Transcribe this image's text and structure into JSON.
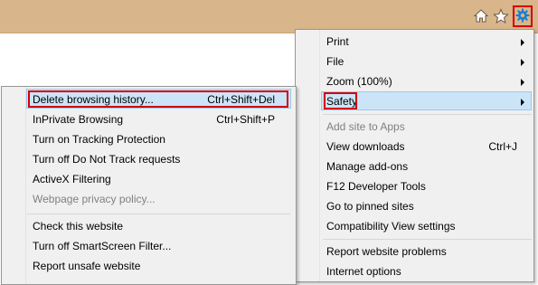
{
  "toolbar": {
    "icons": [
      "home-icon",
      "favorites-star-icon",
      "tools-gear-icon"
    ]
  },
  "main_menu": {
    "items": [
      {
        "label": "Print",
        "has_submenu": true
      },
      {
        "label": "File",
        "has_submenu": true
      },
      {
        "label": "Zoom (100%)",
        "has_submenu": true
      },
      {
        "label": "Safety",
        "has_submenu": true,
        "highlighted": true
      },
      {
        "label": "Add site to Apps",
        "disabled": true
      },
      {
        "label": "View downloads",
        "shortcut": "Ctrl+J"
      },
      {
        "label": "Manage add-ons"
      },
      {
        "label": "F12 Developer Tools"
      },
      {
        "label": "Go to pinned sites"
      },
      {
        "label": "Compatibility View settings"
      },
      {
        "label": "Report website problems"
      },
      {
        "label": "Internet options"
      }
    ]
  },
  "safety_submenu": {
    "items": [
      {
        "label": "Delete browsing history...",
        "shortcut": "Ctrl+Shift+Del",
        "highlighted": true
      },
      {
        "label": "InPrivate Browsing",
        "shortcut": "Ctrl+Shift+P"
      },
      {
        "label": "Turn on Tracking Protection"
      },
      {
        "label": "Turn off Do Not Track requests"
      },
      {
        "label": "ActiveX Filtering"
      },
      {
        "label": "Webpage privacy policy...",
        "disabled": true
      },
      {
        "label": "Check this website"
      },
      {
        "label": "Turn off SmartScreen Filter..."
      },
      {
        "label": "Report unsafe website"
      }
    ]
  },
  "colors": {
    "toolbar_bg": "#d8b58a",
    "menu_bg": "#f0f0f0",
    "highlight_bg": "#cce4f7",
    "annotation_red": "#d40000",
    "gear_blue": "#1a7fd0"
  }
}
